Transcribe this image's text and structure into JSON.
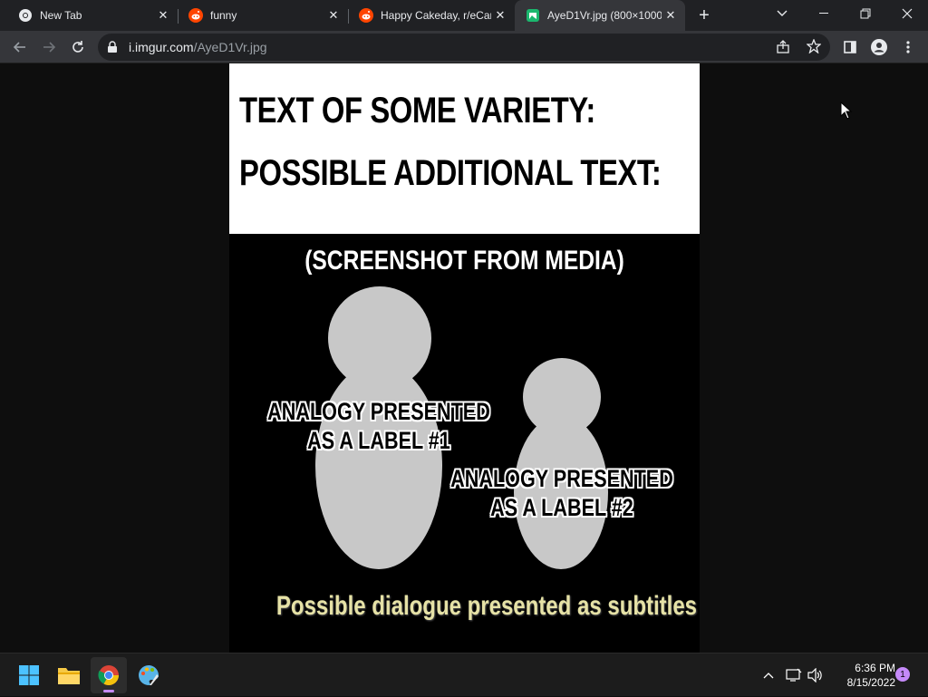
{
  "browser": {
    "tabs": [
      {
        "title": "New Tab",
        "icon": "chrome-icon",
        "active": false
      },
      {
        "title": "funny",
        "icon": "reddit-icon",
        "active": false
      },
      {
        "title": "Happy Cakeday, r/eCar",
        "icon": "reddit-icon",
        "active": false
      },
      {
        "title": "AyeD1Vr.jpg (800×1000",
        "icon": "imgur-icon",
        "active": true
      }
    ],
    "new_tab_symbol": "+",
    "window_controls": {
      "minimize": "—",
      "restore": "❐",
      "close": "✕"
    },
    "address": {
      "host": "i.imgur.com",
      "path": "/AyeD1Vr.jpg"
    }
  },
  "image": {
    "line1": "TEXT OF SOME VARIETY:",
    "line2": "POSSIBLE ADDITIONAL TEXT:",
    "screenshot_caption": "(SCREENSHOT FROM MEDIA)",
    "label1_line1": "ANALOGY PRESENTED",
    "label1_line2": "AS A LABEL #1",
    "label2_line1": "ANALOGY PRESENTED",
    "label2_line2": "AS A LABEL #2",
    "subtitle": "Possible dialogue presented as subtitles",
    "colors": {
      "figure": "#c8c8c8",
      "subtitle": "#e6e2a6",
      "panel": "#ffffff",
      "background": "#000000"
    }
  },
  "taskbar": {
    "apps": [
      "start-icon",
      "file-explorer-icon",
      "chrome-icon",
      "paint-icon"
    ],
    "clock": {
      "time": "6:36 PM",
      "date": "8/15/2022"
    },
    "notification_count": "1"
  }
}
